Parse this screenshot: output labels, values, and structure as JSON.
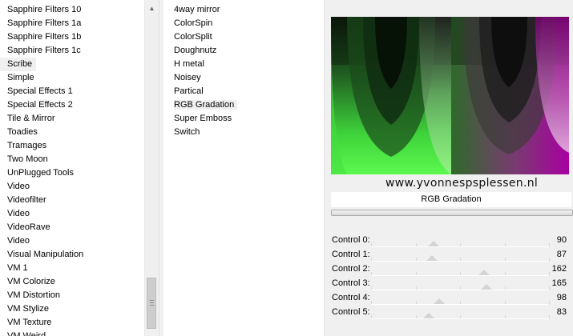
{
  "categories": [
    "Sapphire Filters 10",
    "Sapphire Filters 1a",
    "Sapphire Filters 1b",
    "Sapphire Filters 1c",
    "Scribe",
    "Simple",
    "Special Effects 1",
    "Special Effects 2",
    "Tile & Mirror",
    "Toadies",
    "Tramages",
    "Two Moon",
    "UnPlugged Tools",
    "Video",
    "Videofilter",
    "Video",
    "VideoRave",
    "Video",
    "Visual Manipulation",
    "VM 1",
    "VM Colorize",
    "VM Distortion",
    "VM Stylize",
    "VM Texture",
    "VM Weird"
  ],
  "selected_category": "Scribe",
  "filters": [
    "4way mirror",
    "ColorSpin",
    "ColorSplit",
    "Doughnutz",
    "H metal",
    "Noisey",
    "Partical",
    "RGB Gradation",
    "Super Emboss",
    "Switch"
  ],
  "selected_filter": "RGB Gradation",
  "watermark": "www.yvonnespsplessen.nl",
  "filter_title": "RGB Gradation",
  "controls": [
    {
      "label": "Control 0:",
      "value": 90
    },
    {
      "label": "Control 1:",
      "value": 87
    },
    {
      "label": "Control 2:",
      "value": 162
    },
    {
      "label": "Control 3:",
      "value": 165
    },
    {
      "label": "Control 4:",
      "value": 98
    },
    {
      "label": "Control 5:",
      "value": 83
    }
  ],
  "control_max": 255,
  "scroll_icons": {
    "up": "scroll-up-arrow-icon",
    "down": "scroll-down-arrow-icon"
  }
}
